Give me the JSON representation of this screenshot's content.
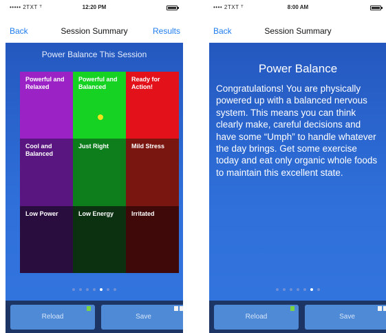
{
  "statusbar": {
    "left": {
      "carrier": "••••• 2TXT ᵀ",
      "time": "12:20 PM"
    },
    "right": {
      "carrier": "•••• 2TXT ᵀ",
      "time": "8:00 AM"
    }
  },
  "nav": {
    "back_label": "Back",
    "title": "Session Summary",
    "results_label": "Results"
  },
  "grid": {
    "title": "Power Balance This Session",
    "cells": [
      {
        "label": "Powerful and Relaxed",
        "color": "#9b22c4"
      },
      {
        "label": "Powerful and Balanced",
        "color": "#15d223"
      },
      {
        "label": "Ready for Action!",
        "color": "#e3121a"
      },
      {
        "label": "Cool and Balanced",
        "color": "#5a1680"
      },
      {
        "label": "Just Right",
        "color": "#0e7d1c"
      },
      {
        "label": "Mild Stress",
        "color": "#7a1610"
      },
      {
        "label": "Low Power",
        "color": "#2a0d3f"
      },
      {
        "label": "Low Energy",
        "color": "#0b3110"
      },
      {
        "label": "Irritated",
        "color": "#3e0908"
      }
    ]
  },
  "card": {
    "title": "Power Balance",
    "text": "Congratulations! You are physically powered up with a balanced nervous system. This means you can think clearly make, careful decisions and have some “Umph” to handle whatever the day brings. Get some exercise today and eat only organic whole foods to maintain this excellent state."
  },
  "toolbar": {
    "left_label": "Reload",
    "right_label": "Save"
  },
  "colors": {
    "accent": "#1e7cf0",
    "content_bg": "#2f6fd9",
    "toolbar_bg": "#1d3565",
    "button_bg": "#4f8ad6"
  },
  "pager": {
    "dots": 7,
    "left_active": 4,
    "right_active": 5
  }
}
